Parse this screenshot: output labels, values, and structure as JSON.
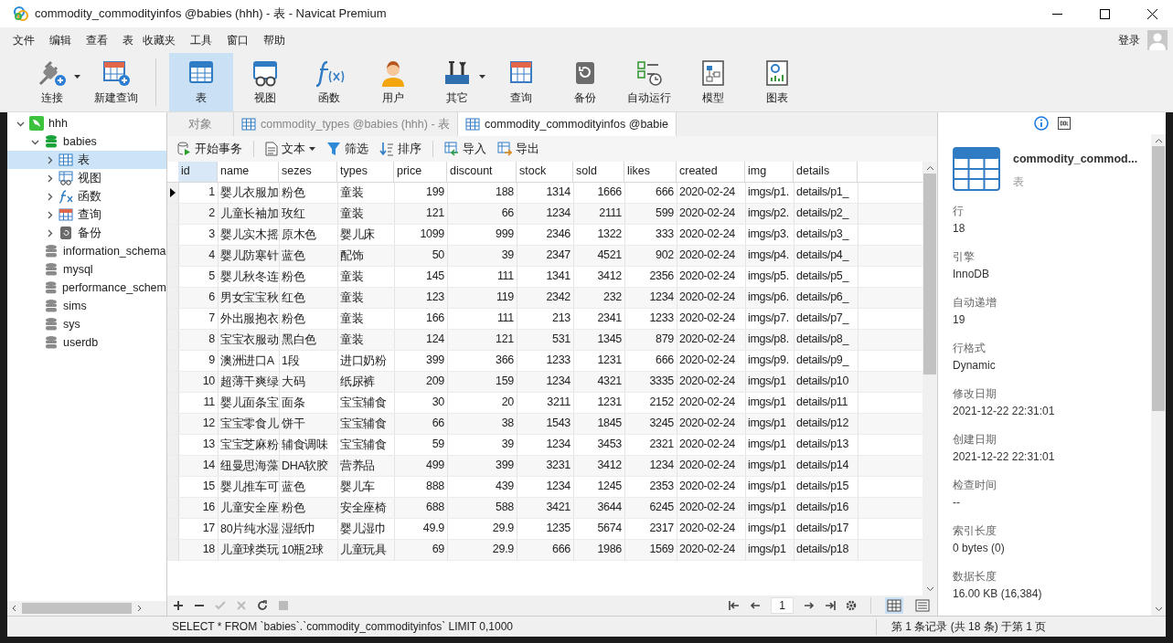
{
  "window": {
    "title": "commodity_commodityinfos @babies (hhh) - 表 - Navicat Premium"
  },
  "menu": [
    "文件",
    "编辑",
    "查看",
    "表",
    "收藏夹",
    "工具",
    "窗口",
    "帮助"
  ],
  "login": "登录",
  "toolbar": [
    {
      "label": "连接",
      "kind": "connect",
      "selected": false,
      "dropdown": true
    },
    {
      "label": "新建查询",
      "kind": "newquery",
      "selected": false,
      "dropdown": false
    },
    {
      "label": "表",
      "kind": "table",
      "selected": true,
      "dropdown": false
    },
    {
      "label": "视图",
      "kind": "view",
      "selected": false,
      "dropdown": false
    },
    {
      "label": "函数",
      "kind": "function",
      "selected": false,
      "dropdown": false
    },
    {
      "label": "用户",
      "kind": "user",
      "selected": false,
      "dropdown": false
    },
    {
      "label": "其它",
      "kind": "tools",
      "selected": false,
      "dropdown": true
    },
    {
      "label": "查询",
      "kind": "query",
      "selected": false,
      "dropdown": false
    },
    {
      "label": "备份",
      "kind": "backup",
      "selected": false,
      "dropdown": false
    },
    {
      "label": "自动运行",
      "kind": "schedule",
      "selected": false,
      "dropdown": false
    },
    {
      "label": "模型",
      "kind": "model",
      "selected": false,
      "dropdown": false
    },
    {
      "label": "图表",
      "kind": "chart",
      "selected": false,
      "dropdown": false
    }
  ],
  "tree": [
    {
      "label": "hhh",
      "kind": "connection",
      "expanded": true,
      "selected": false,
      "children": [
        {
          "label": "babies",
          "kind": "database-open",
          "expanded": true,
          "selected": false,
          "children": [
            {
              "label": "表",
              "kind": "table",
              "expanded": false,
              "selected": true
            },
            {
              "label": "视图",
              "kind": "view",
              "expanded": false,
              "selected": false
            },
            {
              "label": "函数",
              "kind": "function",
              "expanded": false,
              "selected": false
            },
            {
              "label": "查询",
              "kind": "query",
              "expanded": false,
              "selected": false
            },
            {
              "label": "备份",
              "kind": "backup",
              "expanded": false,
              "selected": false
            }
          ]
        },
        {
          "label": "information_schema",
          "kind": "database",
          "selected": false
        },
        {
          "label": "mysql",
          "kind": "database",
          "selected": false
        },
        {
          "label": "performance_schem",
          "kind": "database",
          "selected": false
        },
        {
          "label": "sims",
          "kind": "database",
          "selected": false
        },
        {
          "label": "sys",
          "kind": "database",
          "selected": false
        },
        {
          "label": "userdb",
          "kind": "database",
          "selected": false
        }
      ]
    }
  ],
  "tabs": [
    {
      "label": "对象",
      "kind": "objects",
      "selected": false
    },
    {
      "label": "commodity_types @babies (hhh) - 表",
      "kind": "table",
      "selected": false
    },
    {
      "label": "commodity_commodityinfos @babie",
      "kind": "table",
      "selected": true
    }
  ],
  "grid_toolbar": [
    {
      "label": "开始事务",
      "kind": "transaction",
      "dropdown": false
    },
    {
      "label": "文本",
      "kind": "text",
      "dropdown": true
    },
    {
      "label": "筛选",
      "kind": "filter",
      "dropdown": false
    },
    {
      "label": "排序",
      "kind": "sort",
      "dropdown": false
    },
    {
      "label": "导入",
      "kind": "import",
      "dropdown": false
    },
    {
      "label": "导出",
      "kind": "export",
      "dropdown": false
    }
  ],
  "table": {
    "columns": [
      {
        "label": "id",
        "kind": "number",
        "selected": true
      },
      {
        "label": "name",
        "kind": "text",
        "selected": false
      },
      {
        "label": "sezes",
        "kind": "text",
        "selected": false
      },
      {
        "label": "types",
        "kind": "text",
        "selected": false
      },
      {
        "label": "price",
        "kind": "number",
        "selected": false
      },
      {
        "label": "discount",
        "kind": "number",
        "selected": false
      },
      {
        "label": "stock",
        "kind": "number",
        "selected": false
      },
      {
        "label": "sold",
        "kind": "number",
        "selected": false
      },
      {
        "label": "likes",
        "kind": "number",
        "selected": false
      },
      {
        "label": "created",
        "kind": "text",
        "selected": false
      },
      {
        "label": "img",
        "kind": "text",
        "selected": false
      },
      {
        "label": "details",
        "kind": "text",
        "selected": false
      }
    ],
    "rows": [
      {
        "current": true,
        "cells": [
          "1",
          "婴儿衣服加",
          "粉色",
          "童装",
          "199",
          "188",
          "1314",
          "1666",
          "666",
          "2020-02-24",
          "imgs/p1.",
          "details/p1_"
        ]
      },
      {
        "current": false,
        "cells": [
          "2",
          "儿童长袖加",
          "玫红",
          "童装",
          "121",
          "66",
          "1234",
          "2111",
          "599",
          "2020-02-24",
          "imgs/p2.",
          "details/p2_"
        ]
      },
      {
        "current": false,
        "cells": [
          "3",
          "婴儿实木摇",
          "原木色",
          "婴儿床",
          "1099",
          "999",
          "2346",
          "1322",
          "333",
          "2020-02-24",
          "imgs/p3.",
          "details/p3_"
        ]
      },
      {
        "current": false,
        "cells": [
          "4",
          "婴儿防寒针",
          "蓝色",
          "配饰",
          "50",
          "39",
          "2347",
          "4521",
          "902",
          "2020-02-24",
          "imgs/p4.",
          "details/p4_"
        ]
      },
      {
        "current": false,
        "cells": [
          "5",
          "婴儿秋冬连",
          "粉色",
          "童装",
          "145",
          "111",
          "1341",
          "3412",
          "2356",
          "2020-02-24",
          "imgs/p5.",
          "details/p5_"
        ]
      },
      {
        "current": false,
        "cells": [
          "6",
          "男女宝宝秋",
          "红色",
          "童装",
          "123",
          "119",
          "2342",
          "232",
          "1234",
          "2020-02-24",
          "imgs/p6.",
          "details/p6_"
        ]
      },
      {
        "current": false,
        "cells": [
          "7",
          "外出服抱衣",
          "粉色",
          "童装",
          "166",
          "111",
          "213",
          "2341",
          "1233",
          "2020-02-24",
          "imgs/p7.",
          "details/p7_"
        ]
      },
      {
        "current": false,
        "cells": [
          "8",
          "宝宝衣服动",
          "黑白色",
          "童装",
          "124",
          "121",
          "531",
          "1345",
          "879",
          "2020-02-24",
          "imgs/p8.",
          "details/p8_"
        ]
      },
      {
        "current": false,
        "cells": [
          "9",
          "澳洲进口A",
          "1段",
          "进口奶粉",
          "399",
          "366",
          "1233",
          "1231",
          "666",
          "2020-02-24",
          "imgs/p9.",
          "details/p9_"
        ]
      },
      {
        "current": false,
        "cells": [
          "10",
          "超薄干爽绿",
          "大码",
          "纸尿裤",
          "209",
          "159",
          "1234",
          "4321",
          "3335",
          "2020-02-24",
          "imgs/p1",
          "details/p10"
        ]
      },
      {
        "current": false,
        "cells": [
          "11",
          "婴儿面条宝",
          "面条",
          "宝宝辅食",
          "30",
          "20",
          "3211",
          "1231",
          "2152",
          "2020-02-24",
          "imgs/p1",
          "details/p11"
        ]
      },
      {
        "current": false,
        "cells": [
          "12",
          "宝宝零食儿",
          "饼干",
          "宝宝辅食",
          "66",
          "38",
          "1543",
          "1845",
          "3245",
          "2020-02-24",
          "imgs/p1",
          "details/p12"
        ]
      },
      {
        "current": false,
        "cells": [
          "13",
          "宝宝芝麻粉",
          "辅食调味",
          "宝宝辅食",
          "59",
          "39",
          "1234",
          "3453",
          "2321",
          "2020-02-24",
          "imgs/p1",
          "details/p13"
        ]
      },
      {
        "current": false,
        "cells": [
          "14",
          "纽曼思海藻",
          "DHA软胶",
          "营养品",
          "499",
          "399",
          "3231",
          "3412",
          "1234",
          "2020-02-24",
          "imgs/p1",
          "details/p14"
        ]
      },
      {
        "current": false,
        "cells": [
          "15",
          "婴儿推车可",
          "蓝色",
          "婴儿车",
          "888",
          "439",
          "1234",
          "1245",
          "2353",
          "2020-02-24",
          "imgs/p1",
          "details/p15"
        ]
      },
      {
        "current": false,
        "cells": [
          "16",
          "儿童安全座",
          "粉色",
          "安全座椅",
          "688",
          "588",
          "3421",
          "3644",
          "6245",
          "2020-02-24",
          "imgs/p1",
          "details/p16"
        ]
      },
      {
        "current": false,
        "cells": [
          "17",
          "80片纯水湿",
          "湿纸巾",
          "婴儿湿巾",
          "49.9",
          "29.9",
          "1235",
          "5674",
          "2317",
          "2020-02-24",
          "imgs/p1",
          "details/p17"
        ]
      },
      {
        "current": false,
        "cells": [
          "18",
          "儿童球类玩",
          "10瓶2球",
          "儿童玩具",
          "69",
          "29.9",
          "666",
          "1986",
          "1569",
          "2020-02-24",
          "imgs/p1",
          "details/p18"
        ]
      }
    ]
  },
  "pager": {
    "page": "1"
  },
  "info_panel": {
    "name": "commodity_commod...",
    "type": "表",
    "fields": [
      {
        "label": "行",
        "value": "18"
      },
      {
        "label": "引擎",
        "value": "InnoDB"
      },
      {
        "label": "自动递增",
        "value": "19"
      },
      {
        "label": "行格式",
        "value": "Dynamic"
      },
      {
        "label": "修改日期",
        "value": "2021-12-22 22:31:01"
      },
      {
        "label": "创建日期",
        "value": "2021-12-22 22:31:01"
      },
      {
        "label": "检查时间",
        "value": "--"
      },
      {
        "label": "索引长度",
        "value": "0 bytes (0)"
      },
      {
        "label": "数据长度",
        "value": "16.00 KB (16,384)"
      }
    ]
  },
  "status_bar": {
    "sql": "SELECT * FROM `babies`.`commodity_commodityinfos` LIMIT 0,1000",
    "records": "第 1 条记录 (共 18 条) 于第 1 页"
  }
}
